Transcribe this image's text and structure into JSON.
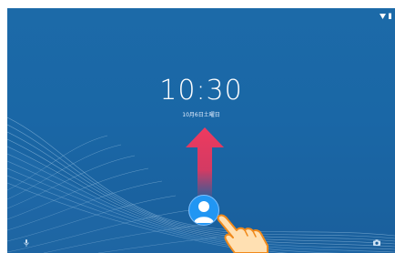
{
  "lockscreen": {
    "time": "10:30",
    "date": "10月6日土曜日"
  },
  "status_bar": {
    "icons": [
      "wifi-icon",
      "battery-icon"
    ]
  },
  "gesture": {
    "direction": "up",
    "icons": [
      "swipe-up-arrow-icon",
      "pointing-hand-icon"
    ]
  },
  "bottom_icons": [
    "microphone-icon",
    "camera-icon"
  ],
  "colors": {
    "background": "#1a67a6",
    "avatar": "#2196f3",
    "arrow": "#e8365c",
    "hand": "#ffe0b2",
    "hand_outline": "#f08a1c",
    "text": "#ffffff"
  }
}
